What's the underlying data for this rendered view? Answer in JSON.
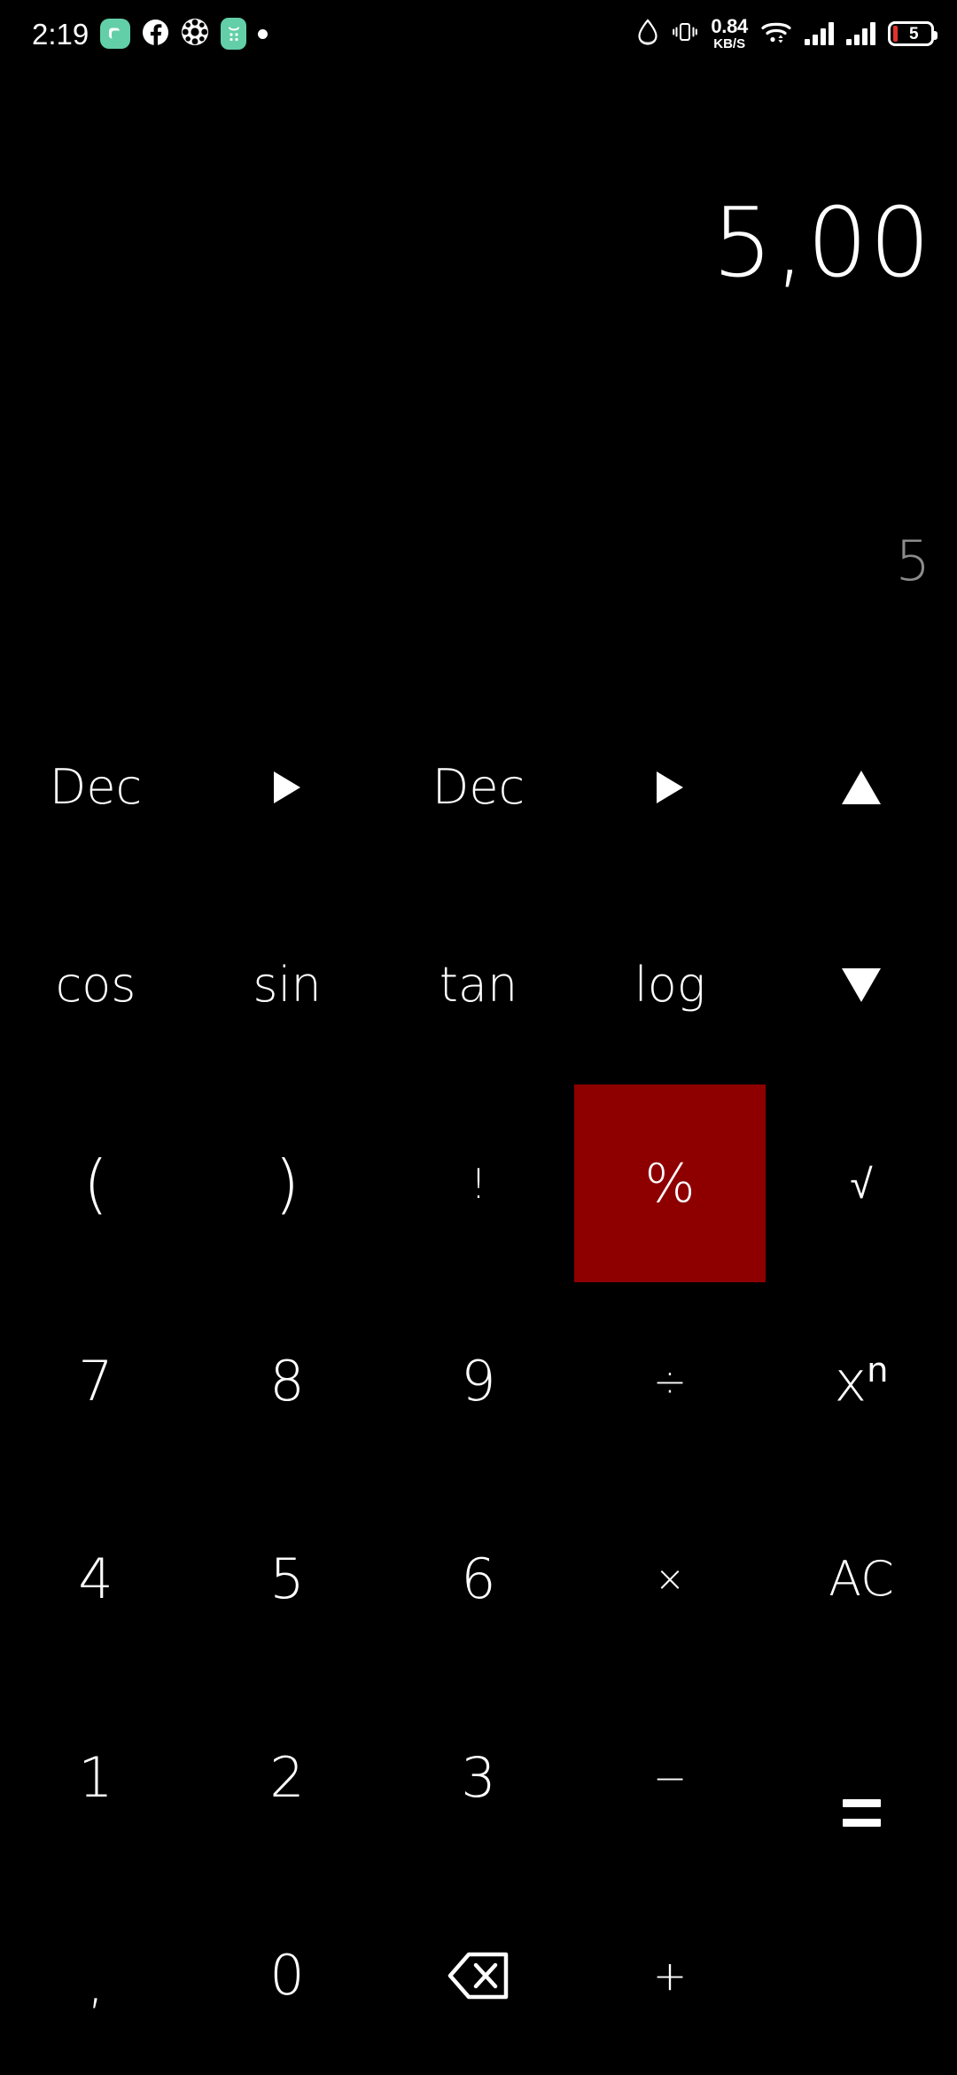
{
  "status_bar": {
    "time": "2:19",
    "left_icons": [
      {
        "name": "messenger-app-icon",
        "kind": "badge-green-rounded"
      },
      {
        "name": "facebook-icon",
        "kind": "facebook"
      },
      {
        "name": "flower-sticker-icon",
        "kind": "flower"
      },
      {
        "name": "green-app-icon",
        "kind": "badge-green-tall"
      },
      {
        "name": "more-dot-icon",
        "kind": "dot"
      }
    ],
    "right_icons": [
      {
        "name": "water-drop-icon",
        "kind": "drop"
      },
      {
        "name": "vibrate-icon",
        "kind": "vibrate"
      }
    ],
    "network_speed": {
      "value": "0.84",
      "unit": "KB/S"
    },
    "wifi": "wifi-icon",
    "signal_1": "signal-bars-icon",
    "signal_2": "signal-bars-icon",
    "battery": {
      "level": "5",
      "label": "battery-icon",
      "low_color": "#e5322d"
    }
  },
  "display": {
    "result": "5,00",
    "expression": "5",
    "result_color": "#ffffff",
    "expression_color": "#8c8c8c"
  },
  "keypad": {
    "highlight_color": "#8e0000",
    "rows": [
      [
        {
          "name": "base-from-button",
          "label": "Dec",
          "type": "word",
          "highlight": false
        },
        {
          "name": "base-arrow-1-button",
          "label": "▶",
          "type": "glyph-tri-right",
          "highlight": false
        },
        {
          "name": "base-to-button",
          "label": "Dec",
          "type": "word",
          "highlight": false
        },
        {
          "name": "base-arrow-2-button",
          "label": "▶",
          "type": "glyph-tri-right",
          "highlight": false
        },
        {
          "name": "scroll-up-button",
          "label": "▲",
          "type": "glyph-tri-up",
          "highlight": false
        }
      ],
      [
        {
          "name": "cos-button",
          "label": "cos",
          "type": "word",
          "highlight": false
        },
        {
          "name": "sin-button",
          "label": "sin",
          "type": "word",
          "highlight": false
        },
        {
          "name": "tan-button",
          "label": "tan",
          "type": "word",
          "highlight": false
        },
        {
          "name": "log-button",
          "label": "log",
          "type": "word",
          "highlight": false
        },
        {
          "name": "scroll-down-button",
          "label": "▼",
          "type": "glyph-tri-down",
          "highlight": false
        }
      ],
      [
        {
          "name": "open-paren-button",
          "label": "(",
          "type": "paren",
          "highlight": false
        },
        {
          "name": "close-paren-button",
          "label": ")",
          "type": "paren",
          "highlight": false
        },
        {
          "name": "factorial-button",
          "label": "!",
          "type": "op",
          "highlight": false
        },
        {
          "name": "percent-button",
          "label": "%",
          "type": "pct",
          "highlight": true
        },
        {
          "name": "sqrt-button",
          "label": "√",
          "type": "op",
          "highlight": false
        }
      ],
      [
        {
          "name": "digit-7-button",
          "label": "7",
          "type": "digit",
          "highlight": false
        },
        {
          "name": "digit-8-button",
          "label": "8",
          "type": "digit",
          "highlight": false
        },
        {
          "name": "digit-9-button",
          "label": "9",
          "type": "digit",
          "highlight": false
        },
        {
          "name": "divide-button",
          "label": "÷",
          "type": "op",
          "highlight": false
        },
        {
          "name": "power-button",
          "label": "x",
          "sup": "n",
          "type": "power",
          "highlight": false
        }
      ],
      [
        {
          "name": "digit-4-button",
          "label": "4",
          "type": "digit",
          "highlight": false
        },
        {
          "name": "digit-5-button",
          "label": "5",
          "type": "digit",
          "highlight": false
        },
        {
          "name": "digit-6-button",
          "label": "6",
          "type": "digit",
          "highlight": false
        },
        {
          "name": "multiply-button",
          "label": "×",
          "type": "small",
          "highlight": false
        },
        {
          "name": "all-clear-button",
          "label": "AC",
          "type": "word",
          "highlight": false
        }
      ],
      [
        {
          "name": "digit-1-button",
          "label": "1",
          "type": "digit",
          "highlight": false
        },
        {
          "name": "digit-2-button",
          "label": "2",
          "type": "digit",
          "highlight": false
        },
        {
          "name": "digit-3-button",
          "label": "3",
          "type": "digit",
          "highlight": false
        },
        {
          "name": "minus-button",
          "label": "−",
          "type": "op",
          "highlight": false
        },
        {
          "name": "equals-button",
          "label": "=",
          "type": "glyph-equals",
          "highlight": false
        }
      ],
      [
        {
          "name": "decimal-comma-button",
          "label": ",",
          "type": "comma",
          "highlight": false
        },
        {
          "name": "digit-0-button",
          "label": "0",
          "type": "digit",
          "highlight": false
        },
        {
          "name": "backspace-button",
          "label": "⌫",
          "type": "glyph-backspace",
          "highlight": false
        },
        {
          "name": "plus-button",
          "label": "+",
          "type": "op",
          "highlight": false
        }
      ]
    ]
  }
}
